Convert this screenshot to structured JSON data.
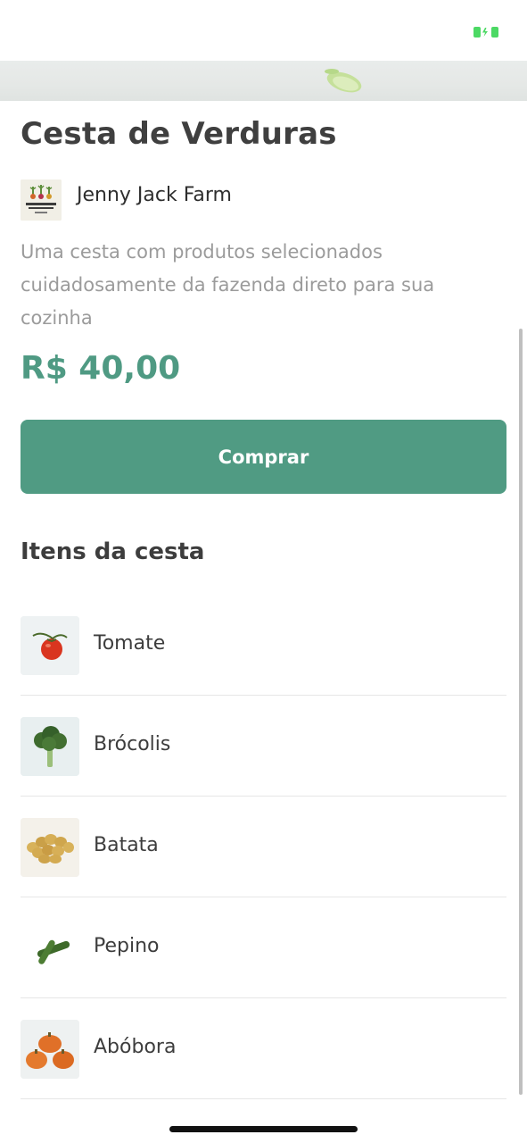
{
  "status_bar": {
    "battery_icon": "battery-charging-icon",
    "battery_color": "#4cd964"
  },
  "hero": {
    "image": "vegetable-hero-image"
  },
  "product": {
    "title": "Cesta de Verduras",
    "farm": {
      "logo": "jenny-jack-farm-logo",
      "name": "Jenny Jack Farm"
    },
    "description": "Uma cesta com produtos selecionados cuidadosamente da fazenda direto para sua cozinha",
    "price": "R$ 40,00",
    "buy_label": "Comprar"
  },
  "basket": {
    "section_title": "Itens da cesta",
    "items": [
      {
        "name": "Tomate",
        "image": "tomato-image"
      },
      {
        "name": "Brócolis",
        "image": "broccoli-image"
      },
      {
        "name": "Batata",
        "image": "potato-image"
      },
      {
        "name": "Pepino",
        "image": "cucumber-image"
      },
      {
        "name": "Abóbora",
        "image": "pumpkin-image"
      }
    ]
  },
  "colors": {
    "accent": "#509b83",
    "title_text": "#3f3f3f",
    "muted_text": "#9b9b9b",
    "divider": "#e6e6e6"
  }
}
